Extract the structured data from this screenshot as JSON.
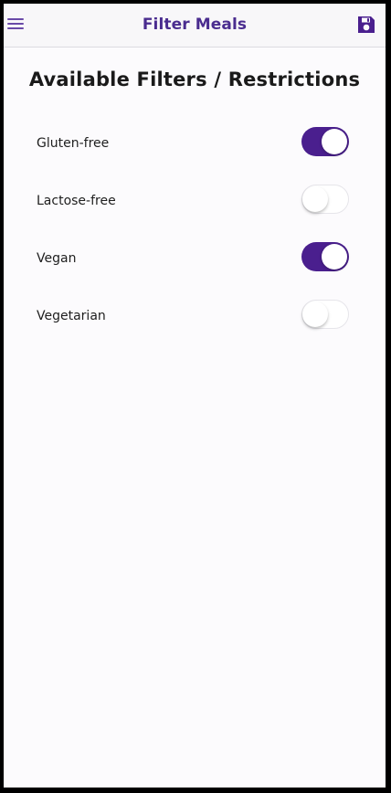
{
  "header": {
    "title": "Filter Meals",
    "menu_icon": "hamburger-menu-icon",
    "save_icon": "floppy-disk-icon"
  },
  "main": {
    "heading": "Available Filters / Restrictions",
    "filters": [
      {
        "label": "Gluten-free",
        "enabled": true
      },
      {
        "label": "Lactose-free",
        "enabled": false
      },
      {
        "label": "Vegan",
        "enabled": true
      },
      {
        "label": "Vegetarian",
        "enabled": false
      }
    ]
  },
  "colors": {
    "accent": "#4a1f8e",
    "title": "#4a2c8f"
  }
}
